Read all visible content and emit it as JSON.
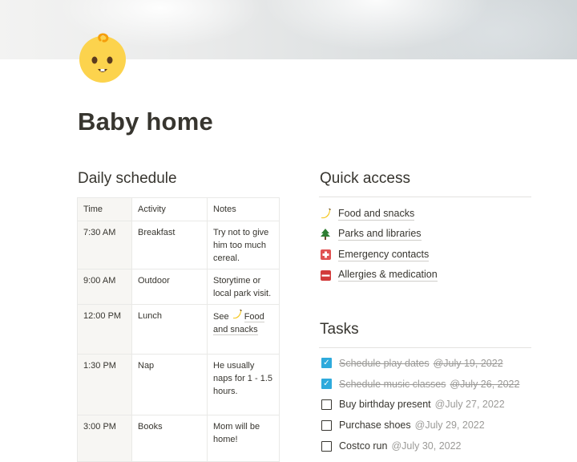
{
  "page": {
    "title": "Baby home",
    "icon": "baby-face-icon"
  },
  "daily_schedule": {
    "heading": "Daily schedule",
    "columns": [
      "Time",
      "Activity",
      "Notes"
    ],
    "rows": [
      {
        "time": "7:30 AM",
        "activity": "Breakfast",
        "notes": "Try not to give him too much cereal."
      },
      {
        "time": "9:00 AM",
        "activity": "Outdoor",
        "notes": "Storytime or local park visit."
      },
      {
        "time": "12:00 PM",
        "activity": "Lunch",
        "notes_prefix": "See",
        "notes_link": "Food and snacks"
      },
      {
        "time": "1:30 PM",
        "activity": "Nap",
        "notes": "He usually naps for 1 - 1.5 hours."
      },
      {
        "time": "3:00 PM",
        "activity": "Books",
        "notes": "Mom will be home!"
      }
    ]
  },
  "quick_access": {
    "heading": "Quick access",
    "items": [
      {
        "label": "Food and snacks",
        "icon": "banana-icon"
      },
      {
        "label": "Parks and libraries",
        "icon": "tree-icon"
      },
      {
        "label": "Emergency contacts",
        "icon": "emergency-icon"
      },
      {
        "label": "Allergies & medication",
        "icon": "sos-icon"
      }
    ]
  },
  "tasks": {
    "heading": "Tasks",
    "items": [
      {
        "label": "Schedule play dates",
        "date": "@July 19, 2022",
        "done": true
      },
      {
        "label": "Schedule music classes",
        "date": "@July 26, 2022",
        "done": true
      },
      {
        "label": "Buy birthday present",
        "date": "@July 27, 2022",
        "done": false
      },
      {
        "label": "Purchase shoes",
        "date": "@July 29, 2022",
        "done": false
      },
      {
        "label": "Costco run",
        "date": "@July 30, 2022",
        "done": false
      }
    ]
  },
  "colors": {
    "text": "#37352f",
    "muted": "#9b9a97",
    "checkbox": "#2eaadc",
    "face": "#fcd34d"
  }
}
